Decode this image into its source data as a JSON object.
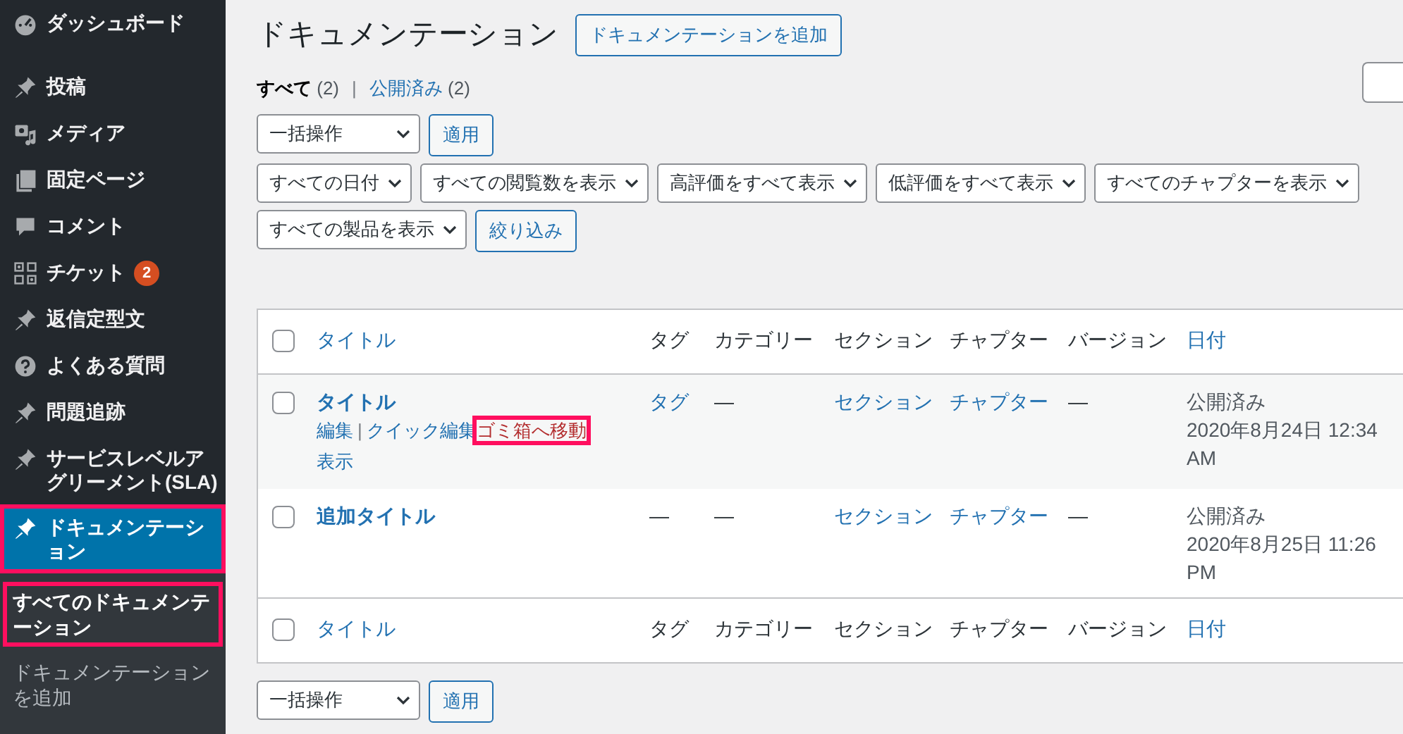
{
  "sidebar": {
    "items": [
      {
        "label": "ダッシュボード",
        "selected": false,
        "highlighted": false
      },
      {
        "label": "投稿",
        "selected": false,
        "highlighted": false
      },
      {
        "label": "メディア",
        "selected": false,
        "highlighted": false
      },
      {
        "label": "固定ページ",
        "selected": false,
        "highlighted": false
      },
      {
        "label": "コメント",
        "selected": false,
        "highlighted": false
      },
      {
        "label": "チケット",
        "badge": "2",
        "selected": false,
        "highlighted": false
      },
      {
        "label": "返信定型文",
        "selected": false,
        "highlighted": false
      },
      {
        "label": "よくある質問",
        "selected": false,
        "highlighted": false
      },
      {
        "label": "問題追跡",
        "selected": false,
        "highlighted": false
      },
      {
        "label": "サービスレベルアグリーメント(SLA)",
        "selected": false,
        "highlighted": false
      },
      {
        "label": "ドキュメンテーション",
        "selected": true,
        "highlighted": true
      }
    ],
    "submenu": [
      {
        "label": "すべてのドキュメンテーション",
        "selected": true,
        "highlighted": true
      },
      {
        "label": "ドキュメンテーションを追加",
        "selected": false,
        "highlighted": false
      }
    ]
  },
  "page": {
    "title": "ドキュメンテーション",
    "add_button": "ドキュメンテーションを追加"
  },
  "views": [
    {
      "label": "すべて",
      "count": "(2)",
      "selected": true
    },
    {
      "label": "公開済み",
      "count": "(2)",
      "selected": false,
      "separator": "|"
    }
  ],
  "bulk_top": {
    "select": "一括操作",
    "button": "適用"
  },
  "filters": {
    "selects": [
      "すべての日付",
      "すべての閲覧数を表示",
      "高評価をすべて表示",
      "低評価をすべて表示",
      "すべてのチャプターを表示",
      "すべての製品を表示"
    ],
    "button": "絞り込み"
  },
  "table": {
    "header_checked": false,
    "footer_checked": false,
    "header": [
      {
        "label": "タイトル",
        "sortable": true
      },
      {
        "label": "タグ",
        "sortable": false
      },
      {
        "label": "カテゴリー",
        "sortable": false
      },
      {
        "label": "セクション",
        "sortable": false
      },
      {
        "label": "チャプター",
        "sortable": false
      },
      {
        "label": "バージョン",
        "sortable": false
      },
      {
        "label": "日付",
        "sortable": true
      }
    ],
    "rows": [
      {
        "title": "タイトル",
        "checked": false,
        "hovered": true,
        "actions": [
          {
            "label": "編集",
            "kind": "link",
            "highlighted": false
          },
          {
            "label": "クイック編集",
            "kind": "link",
            "highlighted": false,
            "separator": "|"
          },
          {
            "label": "ゴミ箱へ移動",
            "kind": "trash",
            "highlighted": true
          },
          {
            "label": "表示",
            "kind": "link",
            "highlighted": false
          }
        ],
        "cells": [
          {
            "text": "タグ",
            "link": true
          },
          {
            "text": "—",
            "link": false
          },
          {
            "text": "セクション",
            "link": true
          },
          {
            "text": "チャプター",
            "link": true
          },
          {
            "text": "—",
            "link": false
          }
        ],
        "status": "公開済み",
        "date": "2020年8月24日 12:34 AM"
      },
      {
        "title": "追加タイトル",
        "checked": false,
        "hovered": false,
        "actions": [],
        "cells": [
          {
            "text": "—",
            "link": false
          },
          {
            "text": "—",
            "link": false
          },
          {
            "text": "セクション",
            "link": true
          },
          {
            "text": "チャプター",
            "link": true
          },
          {
            "text": "—",
            "link": false
          }
        ],
        "status": "公開済み",
        "date": "2020年8月25日 11:26 PM"
      }
    ],
    "footer": [
      {
        "label": "タイトル",
        "sortable": true
      },
      {
        "label": "タグ",
        "sortable": false
      },
      {
        "label": "カテゴリー",
        "sortable": false
      },
      {
        "label": "セクション",
        "sortable": false
      },
      {
        "label": "チャプター",
        "sortable": false
      },
      {
        "label": "バージョン",
        "sortable": false
      },
      {
        "label": "日付",
        "sortable": true
      }
    ]
  },
  "bulk_bottom": {
    "select": "一括操作",
    "button": "適用"
  }
}
